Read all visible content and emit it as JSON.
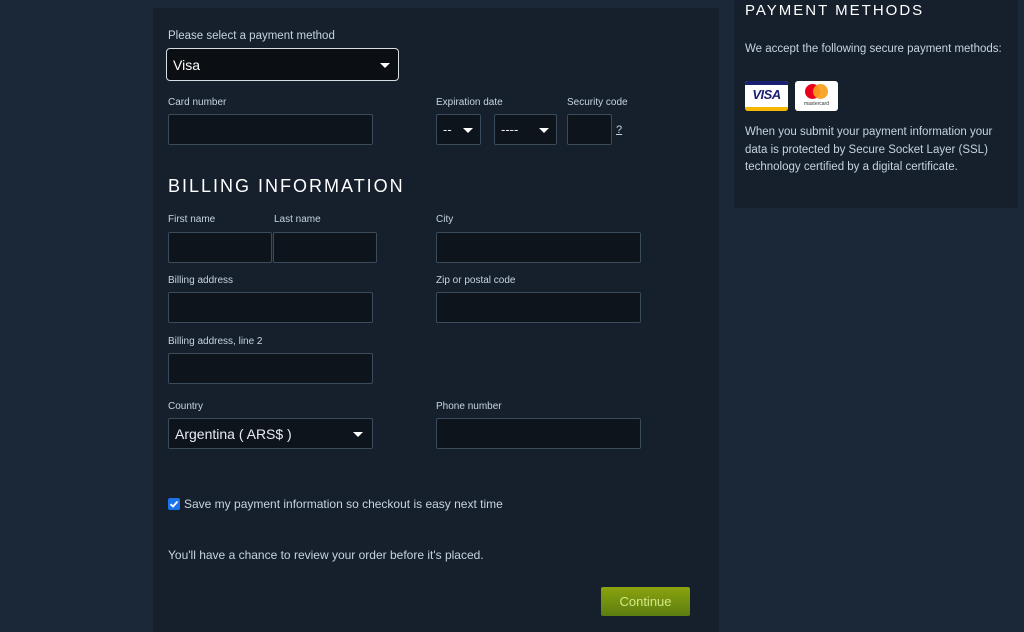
{
  "payment": {
    "method_label": "Please select a payment method",
    "method_value": "Visa",
    "card_number_label": "Card number",
    "expiration_label": "Expiration date",
    "exp_month_value": "--",
    "exp_year_value": "----",
    "security_label": "Security code",
    "security_help": "?"
  },
  "billing": {
    "title": "BILLING INFORMATION",
    "first_name_label": "First name",
    "last_name_label": "Last name",
    "city_label": "City",
    "address_label": "Billing address",
    "zip_label": "Zip or postal code",
    "address2_label": "Billing address, line 2",
    "country_label": "Country",
    "country_value": "Argentina ( ARS$ )",
    "phone_label": "Phone number"
  },
  "save_info_label": "Save my payment information so checkout is easy next time",
  "review_note": "You'll have a chance to review your order before it's placed.",
  "continue_label": "Continue",
  "sidebar": {
    "title": "PAYMENT METHODS",
    "intro": "We accept the following secure payment methods:",
    "visa_logo_text": "VISA",
    "mastercard_logo_text": "mastercard",
    "ssl_text": "When you submit your payment information your data is protected by Secure Socket Layer (SSL) technology certified by a digital certificate."
  },
  "colors": {
    "background": "#1b2838",
    "panel": "#16202d",
    "accent_green": "#8aa30e",
    "checkbox_blue": "#1a73e8"
  }
}
